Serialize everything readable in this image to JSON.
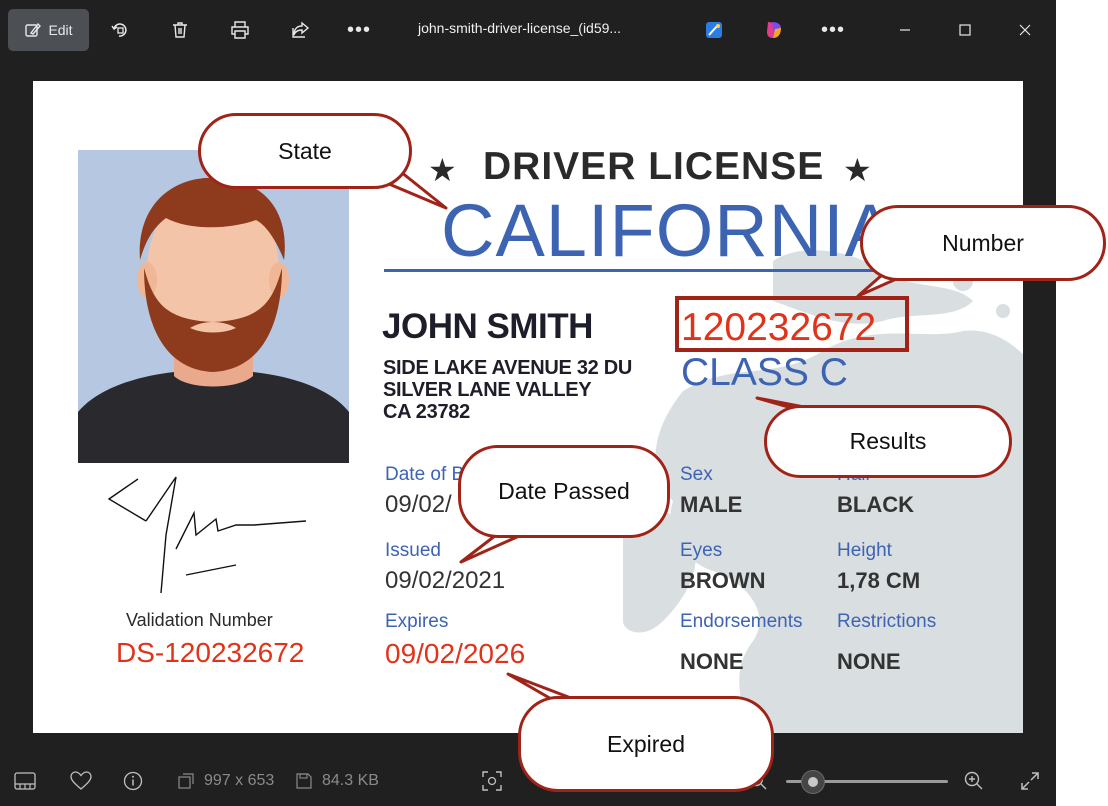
{
  "toolbar": {
    "edit_label": "Edit",
    "file_title": "john-smith-driver-license_(id59..."
  },
  "license": {
    "title": "DRIVER LICENSE",
    "state": "CALIFORNIA",
    "name": "JOHN SMITH",
    "address_line1": "SIDE LAKE AVENUE 32 DU",
    "address_line2": "SILVER LANE VALLEY",
    "address_line3": "CA 23782",
    "number": "120232672",
    "class": "CLASS C",
    "dob_label": "Date of B",
    "dob_value": "09/02/",
    "issued_label": "Issued",
    "issued_value": "09/02/2021",
    "expires_label": "Expires",
    "expires_value": "09/02/2026",
    "sex_label": "Sex",
    "sex_value": "MALE",
    "hair_label": "Hair",
    "hair_value": "BLACK",
    "eyes_label": "Eyes",
    "eyes_value": "BROWN",
    "height_label": "Height",
    "height_value": "1,78 CM",
    "endorsements_label": "Endorsements",
    "endorsements_value": "NONE",
    "restrictions_label": "Restrictions",
    "restrictions_value": "NONE",
    "validation_label": "Validation Number",
    "validation_number": "DS-120232672"
  },
  "callouts": {
    "state": "State",
    "number": "Number",
    "results": "Results",
    "date_passed": "Date Passed",
    "expired": "Expired"
  },
  "status": {
    "dimensions": "997 x 653",
    "file_size": "84.3 KB"
  },
  "colors": {
    "accent_blue": "#3d63b3",
    "accent_red": "#e0331a",
    "callout_border": "#a02318"
  }
}
